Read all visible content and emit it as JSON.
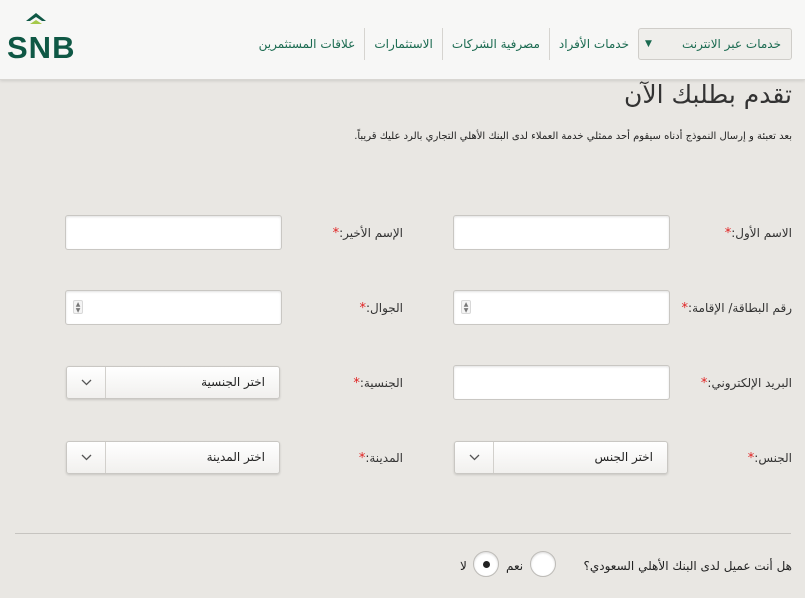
{
  "header": {
    "logo_text": "SNB",
    "brand_color": "#0f5845",
    "nav_dropdown": "خدمات عبر الانترنت",
    "nav_items": [
      "خدمات الأفراد",
      "مصرفية الشركات",
      "الاستثمارات",
      "علاقات المستثمرين"
    ]
  },
  "page": {
    "title": "تقدم بطلبك الآن",
    "intro": "بعد تعبئة و إرسال النموذج أدناه سيقوم أحد ممثلي خدمة العملاء لدى البنك الأهلي التجاري بالرد عليك قريباً."
  },
  "form": {
    "required_mark": "*",
    "first_name_label": "الاسم الأول:",
    "last_name_label": "الإسم الأخير:",
    "id_label": "رقم البطاقة/ الإقامة:",
    "mobile_label": "الجوال:",
    "email_label": "البريد الإلكتروني:",
    "nationality_label": "الجنسية:",
    "nationality_value": "اختر الجنسية",
    "gender_label": "الجنس:",
    "gender_value": "اختر الجنس",
    "city_label": "المدينة:",
    "city_value": "اختر المدينة"
  },
  "customer_question": {
    "text": "هل أنت عميل لدى البنك الأهلي السعودي؟",
    "yes_label": "نعم",
    "no_label": "لا",
    "selected": "no"
  }
}
